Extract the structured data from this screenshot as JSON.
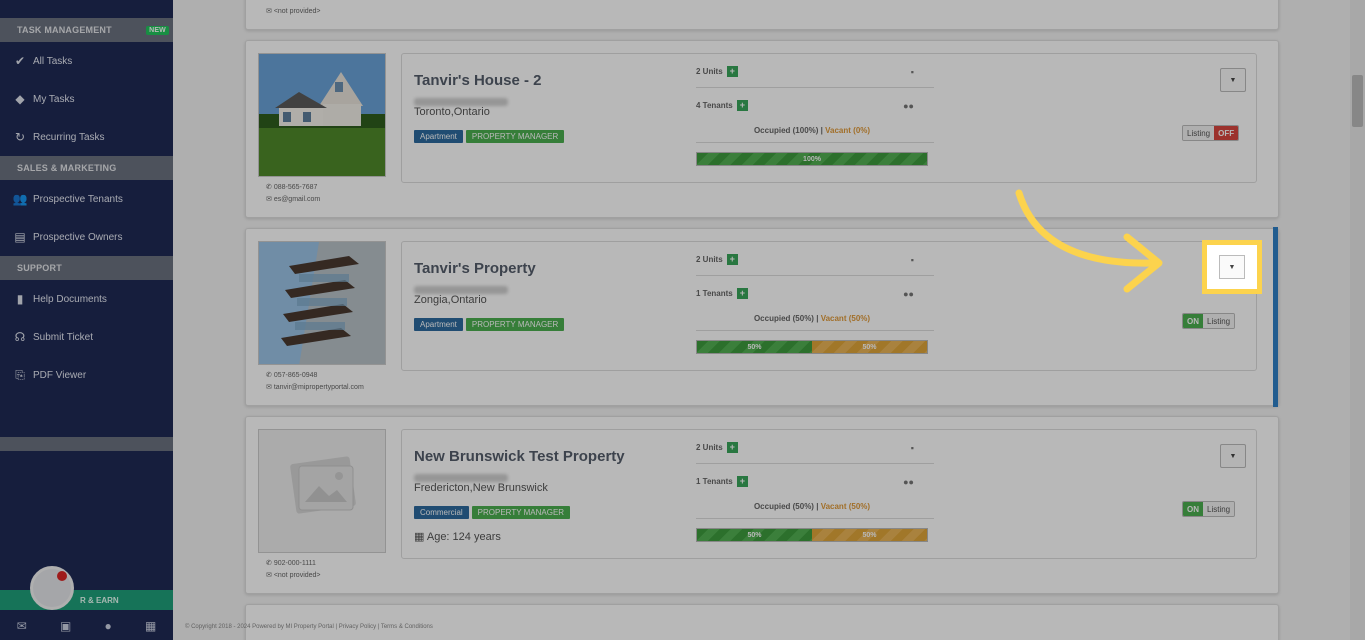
{
  "sidebar": {
    "sections": [
      {
        "title": "TASK MANAGEMENT",
        "badge": "NEW"
      },
      {
        "title": "SALES & MARKETING"
      },
      {
        "title": "SUPPORT"
      }
    ],
    "task_items": [
      {
        "label": "All Tasks",
        "icon": "check-icon"
      },
      {
        "label": "My Tasks",
        "icon": "tag-icon"
      },
      {
        "label": "Recurring Tasks",
        "icon": "refresh-icon"
      }
    ],
    "sales_items": [
      {
        "label": "Prospective Tenants",
        "icon": "users-icon"
      },
      {
        "label": "Prospective Owners",
        "icon": "id-card-icon"
      }
    ],
    "support_items": [
      {
        "label": "Help Documents",
        "icon": "book-icon"
      },
      {
        "label": "Submit Ticket",
        "icon": "headset-icon"
      },
      {
        "label": "PDF Viewer",
        "icon": "pdf-icon"
      }
    ],
    "refer_label": "R & EARN"
  },
  "top_card": {
    "contact_email": "<not provided>"
  },
  "properties": [
    {
      "name": "Tanvir's House - 2",
      "city": "Toronto,Ontario",
      "type_tag": "Apartment",
      "role_tag": "PROPERTY MANAGER",
      "units": "2 Units",
      "tenants": "4 Tenants",
      "occupied": "Occupied (100%)",
      "vacant": "Vacant (0%)",
      "bar": [
        {
          "label": "100%",
          "value": 100,
          "kind": "occupied"
        }
      ],
      "listing_label": "Listing",
      "listing_state": "OFF",
      "phone": "088-565-7687",
      "email": "es@gmail.com"
    },
    {
      "name": "Tanvir's Property",
      "city": "Zongia,Ontario",
      "type_tag": "Apartment",
      "role_tag": "PROPERTY MANAGER",
      "units": "2 Units",
      "tenants": "1 Tenants",
      "occupied": "Occupied (50%)",
      "vacant": "Vacant (50%)",
      "bar": [
        {
          "label": "50%",
          "value": 50,
          "kind": "occupied"
        },
        {
          "label": "50%",
          "value": 50,
          "kind": "vacant"
        }
      ],
      "listing_label": "Listing",
      "listing_state": "ON",
      "phone": "057-865-0948",
      "email": "tanvir@mipropertyportal.com"
    },
    {
      "name": "New Brunswick Test Property",
      "city": "Fredericton,New Brunswick",
      "type_tag": "Commercial",
      "role_tag": "PROPERTY MANAGER",
      "age": "Age: 124 years",
      "units": "2 Units",
      "tenants": "1 Tenants",
      "occupied": "Occupied (50%)",
      "vacant": "Vacant (50%)",
      "bar": [
        {
          "label": "50%",
          "value": 50,
          "kind": "occupied"
        },
        {
          "label": "50%",
          "value": 50,
          "kind": "vacant"
        }
      ],
      "listing_label": "Listing",
      "listing_state": "ON",
      "phone": "902-000-1111",
      "email": "<not provided>"
    }
  ],
  "separator": "|",
  "footer": "© Copyright 2018 - 2024 Powered by MI Property Portal | Privacy Policy | Terms & Conditions",
  "colors": {
    "highlight": "#fcd34d",
    "sidebar": "#1f2a55",
    "accent": "#2f80c7"
  }
}
